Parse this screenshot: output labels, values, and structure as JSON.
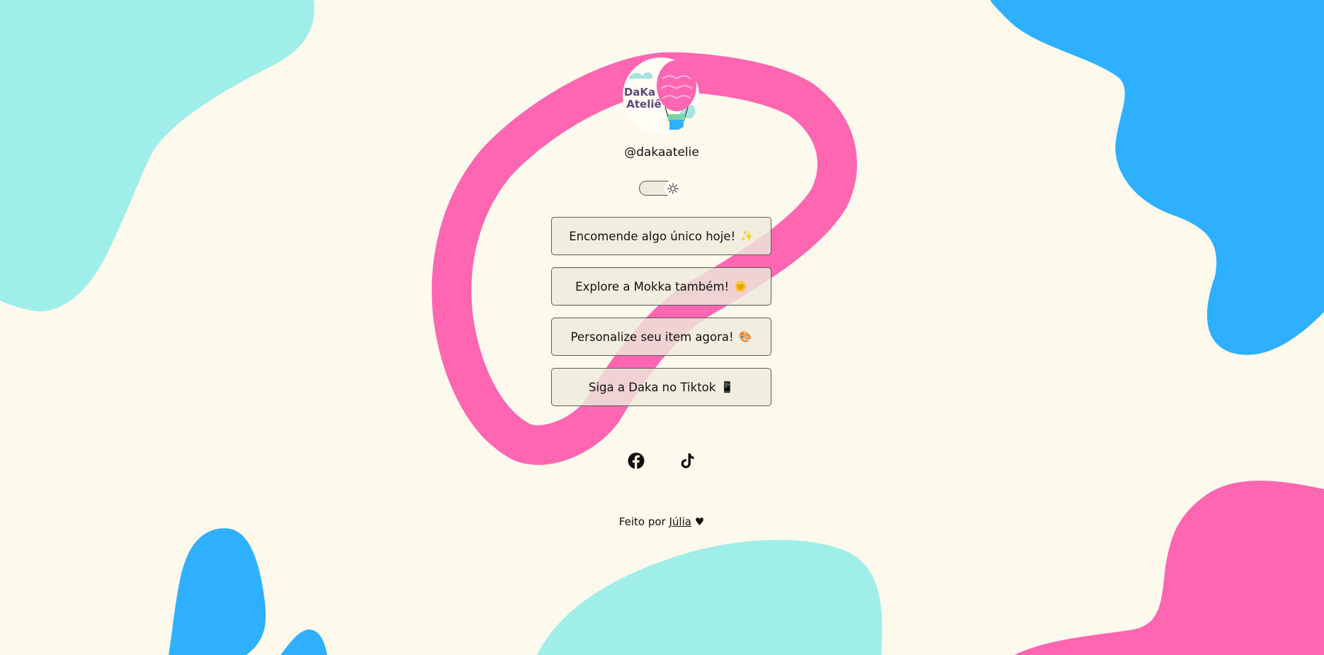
{
  "profile": {
    "avatar_text_line1": "DaKa",
    "avatar_text_line2": "Ateliê",
    "handle": "@dakaatelie"
  },
  "theme_toggle": {
    "icon": "sun-icon",
    "state": "light"
  },
  "links": [
    {
      "label": "Encomende algo único hoje!",
      "emoji": "✨"
    },
    {
      "label": "Explore a Mokka também!",
      "emoji": "🌞"
    },
    {
      "label": "Personalize seu item agora!",
      "emoji": "🎨"
    },
    {
      "label": "Siga a Daka no Tiktok",
      "emoji": "📱"
    }
  ],
  "social": [
    {
      "icon": "facebook-icon"
    },
    {
      "icon": "tiktok-icon"
    }
  ],
  "footer": {
    "prefix": "Feito por",
    "author": "Júlia",
    "heart": "♥"
  },
  "colors": {
    "background": "#fdf9ec",
    "cyan": "#a0eeea",
    "blue": "#2fb0ff",
    "pink": "#ff66b1",
    "button_bg": "#eeeadc"
  }
}
